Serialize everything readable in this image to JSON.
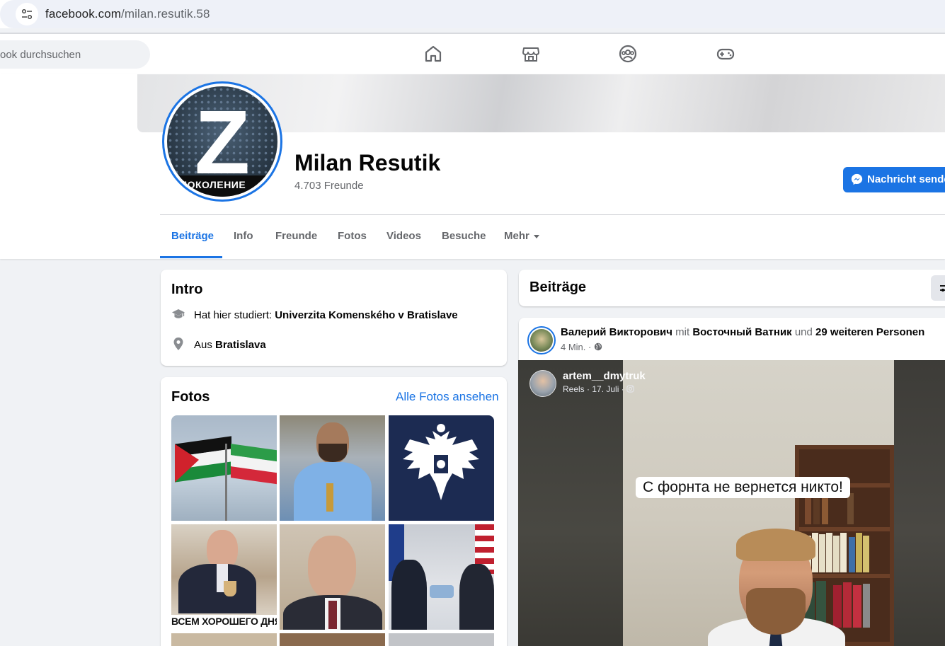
{
  "browser": {
    "url_domain": "facebook.com",
    "url_path": "/milan.resutik.58"
  },
  "topnav": {
    "search_placeholder": "ook durchsuchen",
    "icons": [
      "home-icon",
      "marketplace-icon",
      "groups-icon",
      "gaming-icon"
    ]
  },
  "profile": {
    "name": "Milan Resutik",
    "friends": "4.703 Freunde",
    "avatar_text": "ПОКОЛЕНИЕ",
    "avatar_letter": "Z",
    "message_button": "Nachricht senden"
  },
  "tabs": [
    {
      "label": "Beiträge",
      "active": true
    },
    {
      "label": "Info",
      "active": false
    },
    {
      "label": "Freunde",
      "active": false
    },
    {
      "label": "Fotos",
      "active": false
    },
    {
      "label": "Videos",
      "active": false
    },
    {
      "label": "Besuche",
      "active": false
    },
    {
      "label": "Mehr",
      "active": false
    }
  ],
  "intro": {
    "title": "Intro",
    "studied_prefix": "Hat hier studiert: ",
    "studied_value": "Univerzita Komenského v Bratislave",
    "from_prefix": "Aus ",
    "from_value": "Bratislava"
  },
  "photos": {
    "title": "Fotos",
    "see_all": "Alle Fotos ansehen",
    "overlay_text": "ВСЕМ ХОРОШЕГО ДНЯ!"
  },
  "posts": {
    "title": "Beiträge",
    "post": {
      "author": "Валерий Викторович",
      "with_word": "mit",
      "tagged": "Восточный Ватник",
      "and_word": "und",
      "others": "29 weiteren Personen",
      "time": "4 Min. ·",
      "video": {
        "author": "artem__dmytruk",
        "meta": "Reels · 17. Juli ·",
        "caption": "С форнта не вернется никто!"
      }
    }
  },
  "colors": {
    "accent": "#1b74e4",
    "background": "#f0f2f5",
    "secondary_text": "#65676b"
  }
}
